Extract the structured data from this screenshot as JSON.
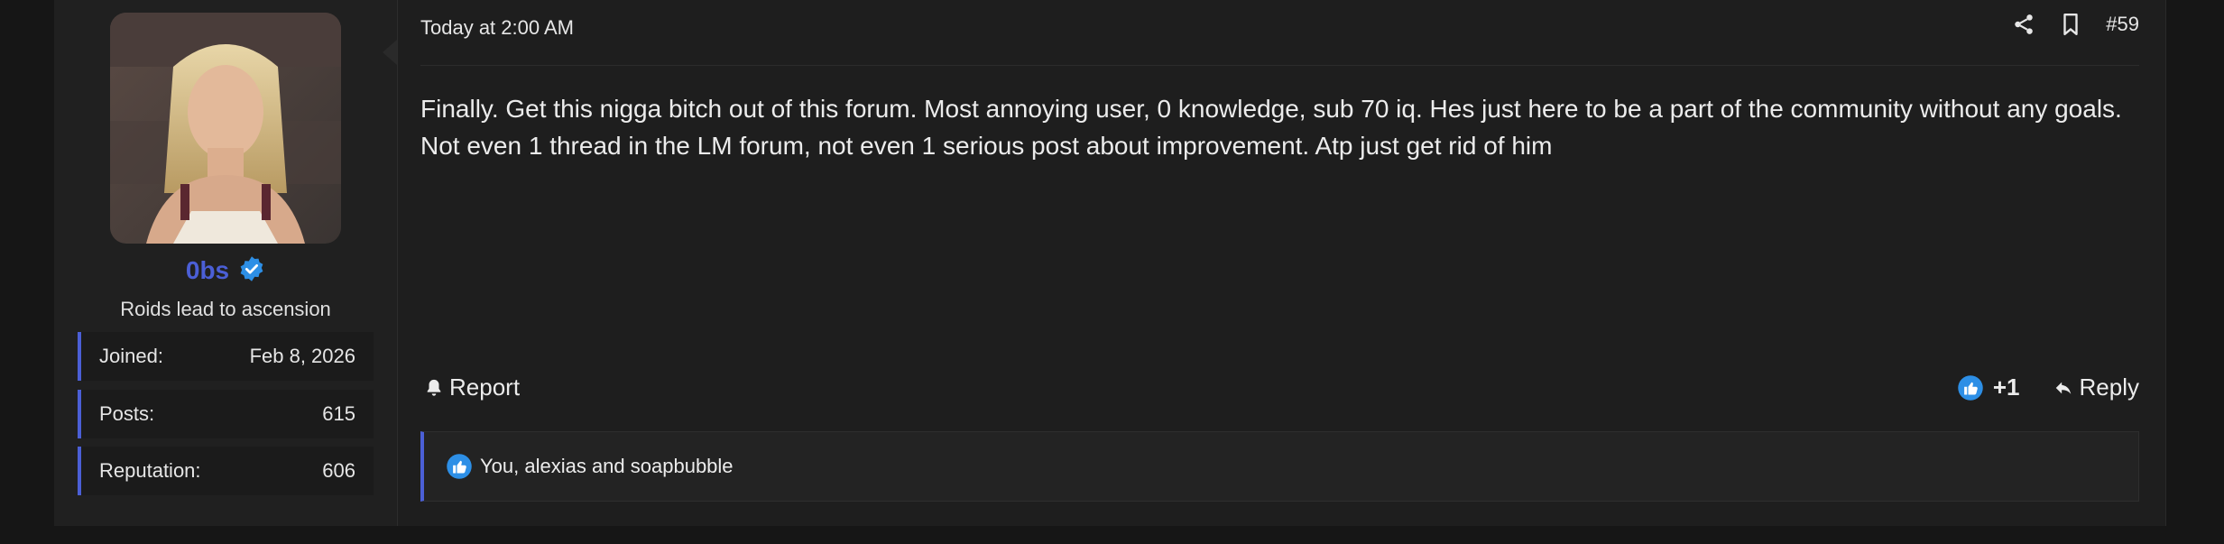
{
  "user": {
    "username": "0bs",
    "title": "Roids lead to ascension",
    "stats": [
      {
        "label": "Joined:",
        "value": "Feb 8, 2026"
      },
      {
        "label": "Posts:",
        "value": "615"
      },
      {
        "label": "Reputation:",
        "value": "606"
      }
    ]
  },
  "post": {
    "time": "Today at 2:00 AM",
    "number": "#59",
    "message": "Finally. Get this nigga bitch out of this forum. Most annoying user, 0 knowledge, sub 70 iq. Hes just here to be a part of the community without any goals. Not even 1 thread in the LM forum, not even 1 serious post about improvement. Atp just get rid of him",
    "report_label": "Report",
    "score": "+1",
    "reply_label": "Reply",
    "reactions_text": "You, alexias and soapbubble"
  },
  "colors": {
    "accent": "#4b5fd6",
    "like_blue": "#2d8fe6",
    "background": "#1e1e1e"
  },
  "icons": [
    "verified-icon",
    "share-icon",
    "bookmark-icon",
    "bell-icon",
    "like-icon",
    "reply-icon"
  ]
}
